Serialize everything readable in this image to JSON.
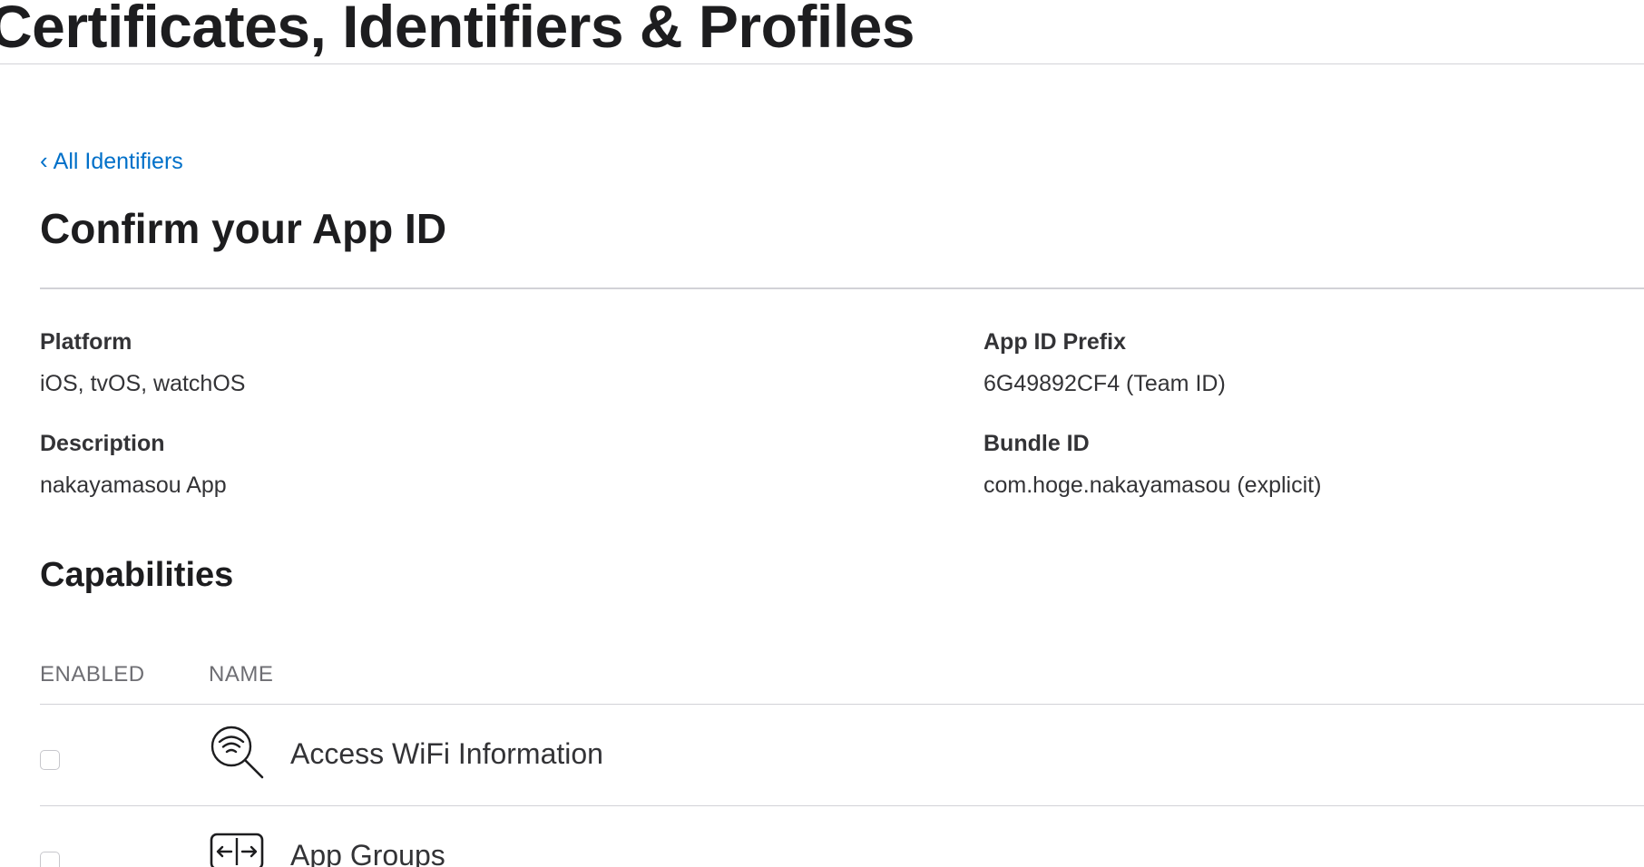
{
  "header": {
    "site_title": "Certificates, Identifiers & Profiles"
  },
  "nav": {
    "back_link_label": "All Identifiers",
    "back_chevron": "‹"
  },
  "page": {
    "heading": "Confirm your App ID"
  },
  "details": {
    "platform": {
      "label": "Platform",
      "value": "iOS, tvOS, watchOS"
    },
    "app_id_prefix": {
      "label": "App ID Prefix",
      "value": "6G49892CF4 (Team ID)"
    },
    "description": {
      "label": "Description",
      "value": "nakayamasou App"
    },
    "bundle_id": {
      "label": "Bundle ID",
      "value": "com.hoge.nakayamasou (explicit)"
    }
  },
  "capabilities": {
    "heading": "Capabilities",
    "columns": {
      "enabled": "ENABLED",
      "name": "NAME"
    },
    "rows": [
      {
        "name": "Access WiFi Information",
        "icon": "wifi-search-icon",
        "enabled": false
      },
      {
        "name": "App Groups",
        "icon": "app-groups-icon",
        "enabled": false
      }
    ]
  },
  "colors": {
    "link": "#0070c9",
    "text": "#1d1d1f",
    "secondary_text": "#6e6e73",
    "divider": "#d2d2d7"
  }
}
